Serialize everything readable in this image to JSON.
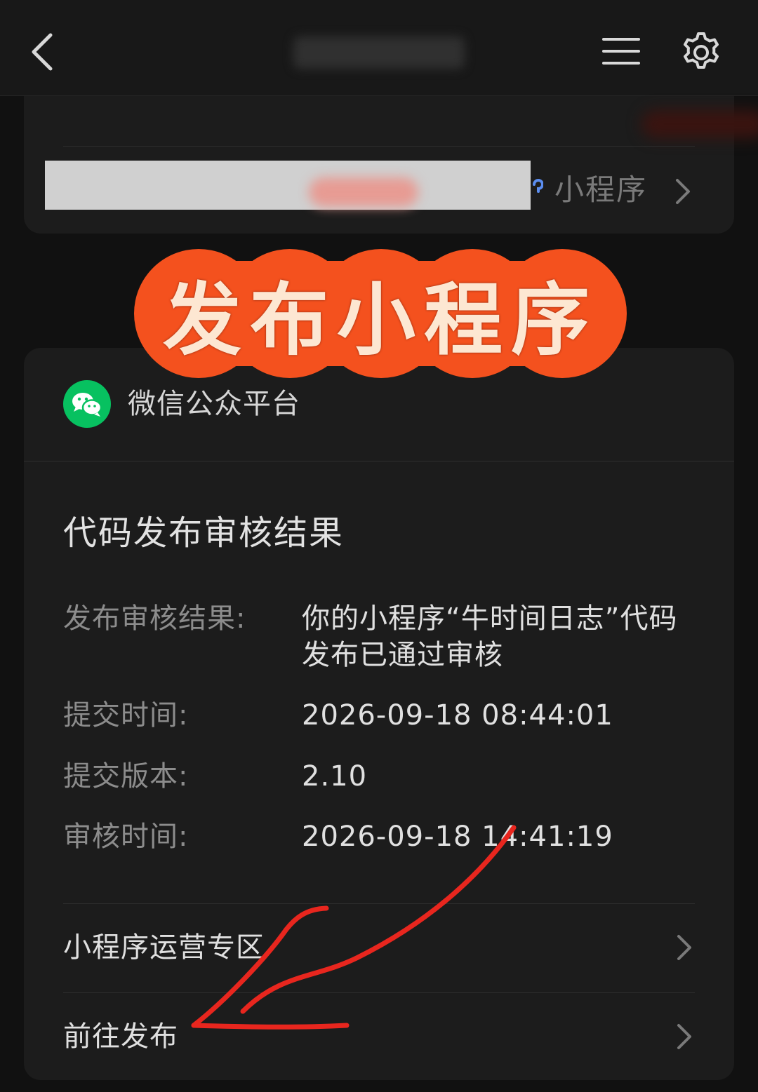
{
  "nav": {
    "icons": {
      "back": "back-arrow-icon",
      "menu": "hamburger-menu-icon",
      "settings": "gear-icon"
    }
  },
  "top_card": {
    "link_label": "小程序",
    "icons": {
      "chevron": "chevron-right-icon"
    }
  },
  "banner": {
    "text": "发布小程序",
    "colors": {
      "fill": "#f4511e",
      "text": "#fde7d2"
    }
  },
  "message": {
    "sender": "微信公众平台",
    "title": "代码发布审核结果",
    "fields": [
      {
        "label": "发布审核结果:",
        "value": "你的小程序“牛时间日志”代码发布已通过审核"
      },
      {
        "label": "提交时间:",
        "value": "2026-09-18 08:44:01"
      },
      {
        "label": "提交版本:",
        "value": "2.10"
      },
      {
        "label": "审核时间:",
        "value": "2026-09-18 14:41:19"
      }
    ],
    "actions": [
      {
        "label": "小程序运营专区"
      },
      {
        "label": "前往发布"
      }
    ]
  },
  "colors": {
    "background": "#111111",
    "card": "#1c1c1c",
    "wechat_green": "#07c160",
    "annotation_red": "#e8261e"
  }
}
